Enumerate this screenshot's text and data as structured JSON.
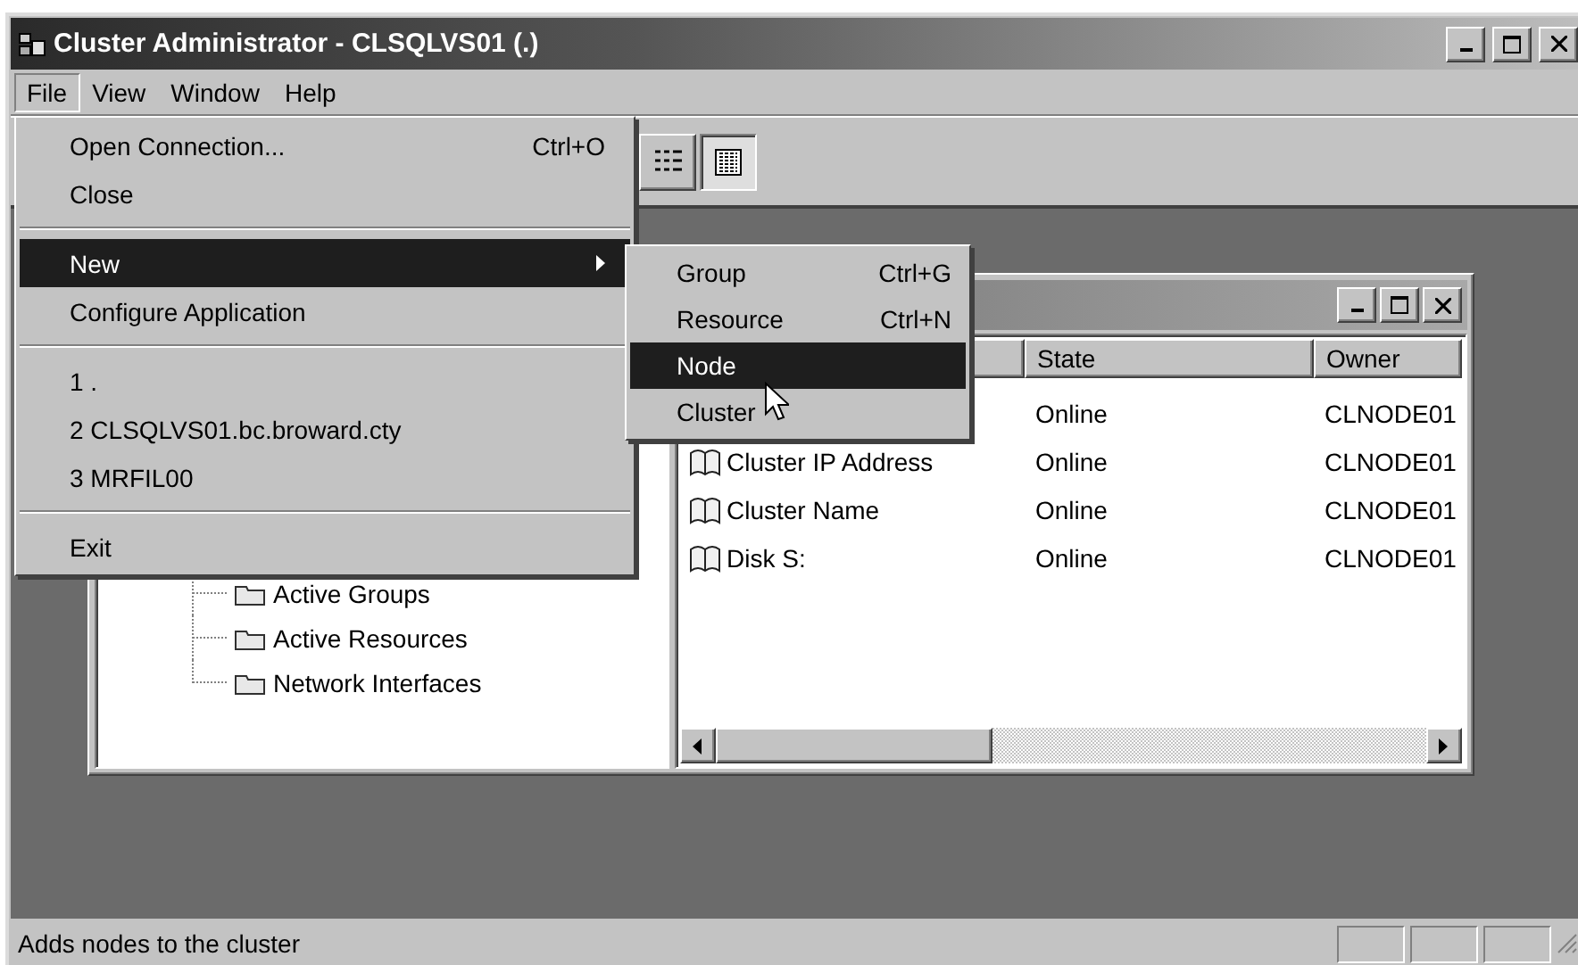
{
  "window": {
    "title": "Cluster Administrator - CLSQLVS01 (.)"
  },
  "menu_bar": [
    {
      "label": "File",
      "selected": true
    },
    {
      "label": "View",
      "selected": false
    },
    {
      "label": "Window",
      "selected": false
    },
    {
      "label": "Help",
      "selected": false
    }
  ],
  "toolbar": {
    "view_buttons": [
      {
        "kind": "list",
        "selected": false
      },
      {
        "kind": "details",
        "selected": true
      }
    ]
  },
  "file_menu": [
    {
      "kind": "item",
      "label": "Open Connection...",
      "shortcut": "Ctrl+O",
      "selected": false
    },
    {
      "kind": "item",
      "label": "Close",
      "selected": false
    },
    {
      "kind": "separator"
    },
    {
      "kind": "submenu",
      "label": "New",
      "selected": true
    },
    {
      "kind": "item",
      "label": "Configure Application",
      "selected": false
    },
    {
      "kind": "separator"
    },
    {
      "kind": "item",
      "label": "1 .",
      "selected": false
    },
    {
      "kind": "item",
      "label": "2 CLSQLVS01.bc.broward.cty",
      "selected": false
    },
    {
      "kind": "item",
      "label": "3 MRFIL00",
      "selected": false
    },
    {
      "kind": "separator"
    },
    {
      "kind": "item",
      "label": "Exit",
      "selected": false
    }
  ],
  "new_submenu": [
    {
      "label": "Group",
      "shortcut": "Ctrl+G",
      "selected": false
    },
    {
      "label": "Resource",
      "shortcut": "Ctrl+N",
      "selected": false
    },
    {
      "label": "Node",
      "selected": true
    },
    {
      "label": "Cluster",
      "selected": false
    }
  ],
  "child_window": {
    "tree": [
      {
        "label": "Active Groups"
      },
      {
        "label": "Active Resources"
      },
      {
        "label": "Network Interfaces"
      }
    ],
    "columns": [
      {},
      {
        "label": "State"
      },
      {
        "label": "Owner"
      }
    ],
    "rows": [
      {
        "state": "Online",
        "owner": "CLNODE01"
      },
      {
        "name": "Cluster IP Address",
        "state": "Online",
        "owner": "CLNODE01"
      },
      {
        "name": "Cluster Name",
        "state": "Online",
        "owner": "CLNODE01"
      },
      {
        "name": "Disk S:",
        "state": "Online",
        "owner": "CLNODE01"
      }
    ]
  },
  "status_bar": {
    "text": "Adds nodes to the cluster"
  }
}
